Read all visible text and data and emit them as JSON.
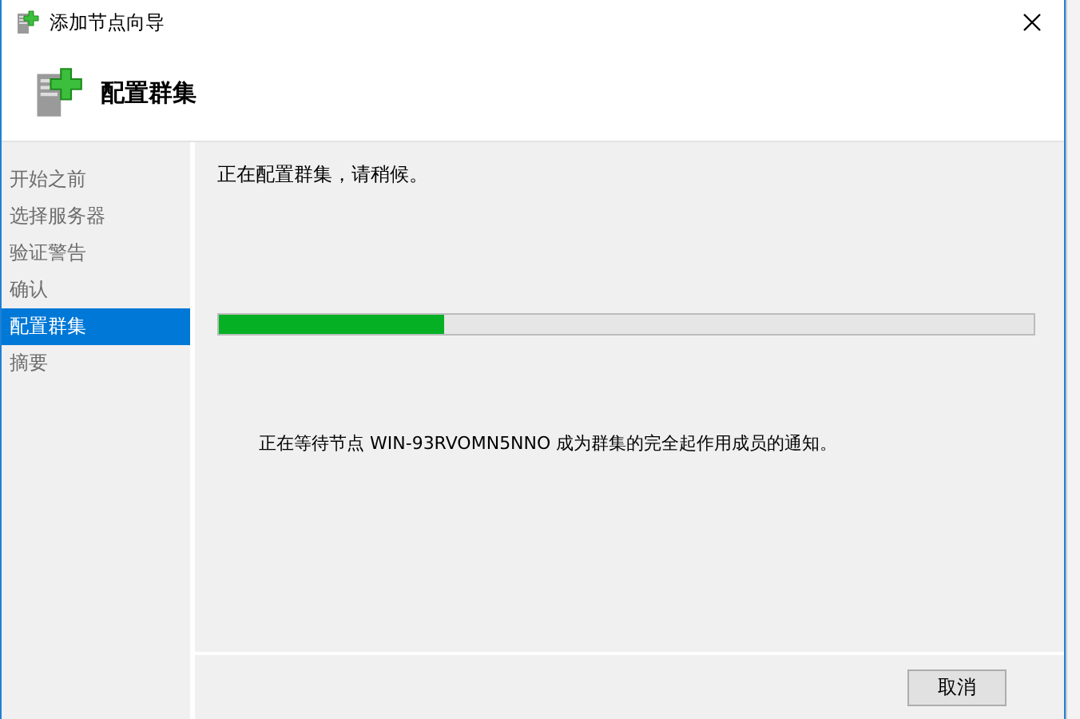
{
  "window": {
    "title": "添加节点向导"
  },
  "header": {
    "title": "配置群集"
  },
  "steps": [
    {
      "label": "开始之前",
      "selected": false
    },
    {
      "label": "选择服务器",
      "selected": false
    },
    {
      "label": "验证警告",
      "selected": false
    },
    {
      "label": "确认",
      "selected": false
    },
    {
      "label": "配置群集",
      "selected": true
    },
    {
      "label": "摘要",
      "selected": false
    }
  ],
  "status": "正在配置群集，请稍候。",
  "progress": {
    "level": 0.276
  },
  "detail": "正在等待节点 WIN-93RVOMN5NNO 成为群集的完全起作用成员的通知。",
  "buttons": [
    {
      "label": "取消"
    }
  ]
}
